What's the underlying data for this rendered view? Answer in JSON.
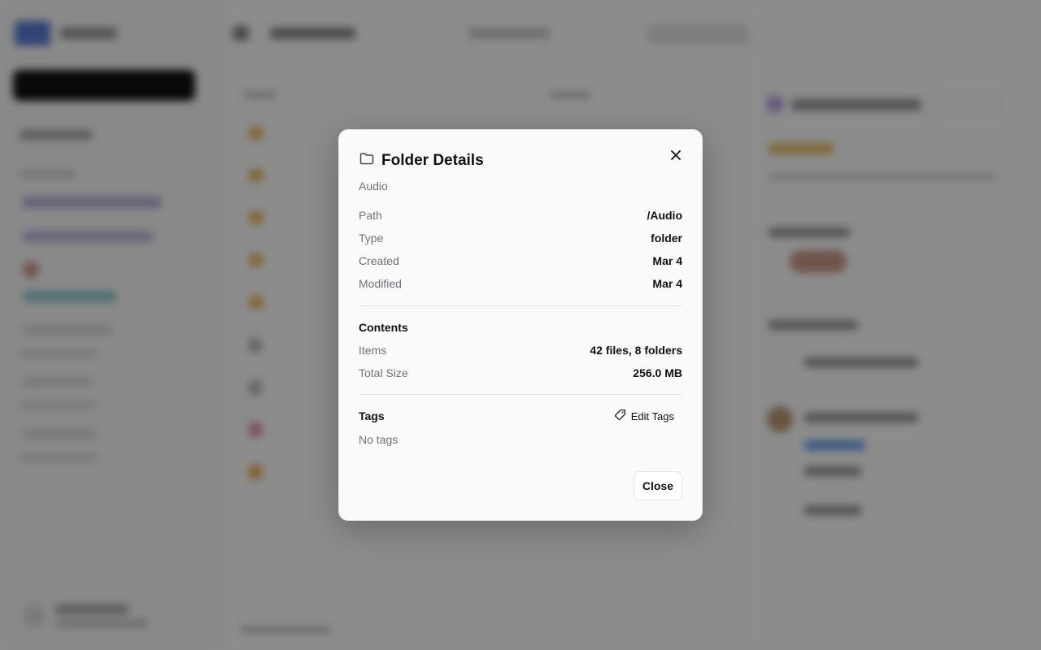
{
  "dialog": {
    "title": "Folder Details",
    "subtitle": "Audio",
    "close_icon": "x-icon",
    "folder_icon": "folder-icon",
    "details": [
      {
        "label": "Path",
        "value": "/Audio"
      },
      {
        "label": "Type",
        "value": "folder"
      },
      {
        "label": "Created",
        "value": "Mar 4"
      },
      {
        "label": "Modified",
        "value": "Mar 4"
      }
    ],
    "contents": {
      "heading": "Contents",
      "items_label": "Items",
      "items_value": "42 files, 8 folders",
      "size_label": "Total Size",
      "size_value": "256.0 MB"
    },
    "tags": {
      "heading": "Tags",
      "edit_label": "Edit Tags",
      "edit_icon": "tag-icon",
      "empty_text": "No tags"
    },
    "close_button": "Close"
  },
  "colors": {
    "overlay": "#000000",
    "dialog_bg": "#fafafa",
    "muted_text": "#71717a",
    "border": "#e4e4e7"
  }
}
